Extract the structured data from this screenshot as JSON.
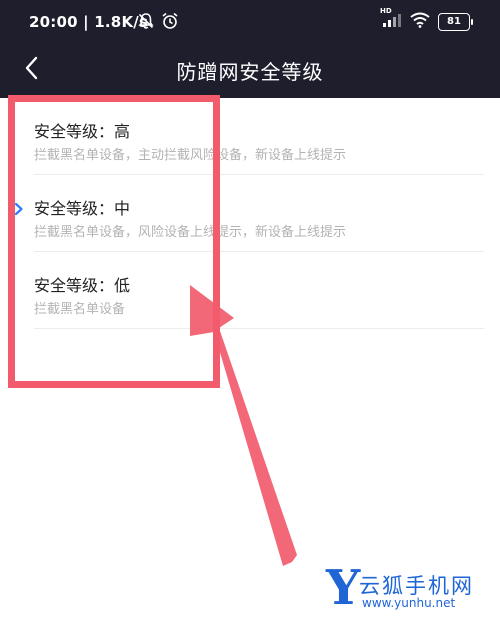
{
  "status_bar": {
    "time_speed": "20:00 | 1.8K/s",
    "hd_label": "HD",
    "battery": "81",
    "icons": [
      "mute-bell-icon",
      "alarm-icon",
      "signal-icon",
      "wifi-icon",
      "battery-icon"
    ]
  },
  "header": {
    "title": "防蹭网安全等级",
    "back_icon": "chevron-left-icon"
  },
  "levels": [
    {
      "title": "安全等级：高",
      "desc": "拦截黑名单设备，主动拦截风险设备，新设备上线提示",
      "selected": false
    },
    {
      "title": "安全等级：中",
      "desc": "拦截黑名单设备，风险设备上线提示，新设备上线提示",
      "selected": true
    },
    {
      "title": "安全等级：低",
      "desc": "拦截黑名单设备",
      "selected": false
    }
  ],
  "colors": {
    "header_bg": "#1e1e2d",
    "accent_check": "#2e7cf6",
    "annotation_red": "#f25b6c",
    "watermark_blue": "#1f65d6"
  },
  "watermark": {
    "logo_letter": "Y",
    "name": "云狐手机网",
    "url": "www.yunhu.net"
  }
}
